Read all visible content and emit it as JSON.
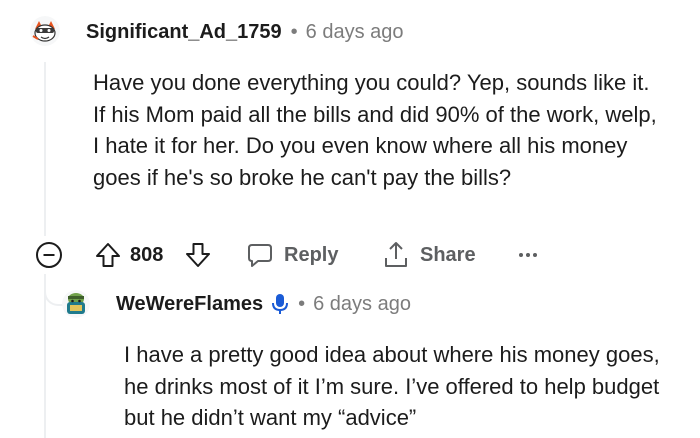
{
  "comment": {
    "username": "Significant_Ad_1759",
    "separator": "•",
    "time": "6 days ago",
    "body": "Have you done everything you could? Yep, sounds like it. If his Mom paid all the bills and did 90% of the work, welp, I hate it for her. Do you even know where all his money goes if he's so broke he can't pay the bills?",
    "avatar_icon": "snoo-avatar-icon"
  },
  "actions": {
    "collapse_icon": "collapse-icon",
    "upvote_icon": "upvote-arrow-icon",
    "score": "808",
    "downvote_icon": "downvote-arrow-icon",
    "reply_label": "Reply",
    "share_label": "Share",
    "more_icon": "ellipsis-icon"
  },
  "reply": {
    "username": "WeWereFlames",
    "verified_icon": "microphone-icon",
    "separator": "•",
    "time": "6 days ago",
    "body": "I have a pretty good idea about where his money goes, he drinks most of it I’m sure. I’ve offered to help budget but he didn’t want my “advice”",
    "avatar_icon": "snoo-avatar-icon"
  },
  "colors": {
    "text": "#1c1c1c",
    "meta": "#7c7c7c",
    "action": "#5d5f61",
    "thread_line": "#edeff1",
    "mic_blue": "#1a5bd6"
  }
}
